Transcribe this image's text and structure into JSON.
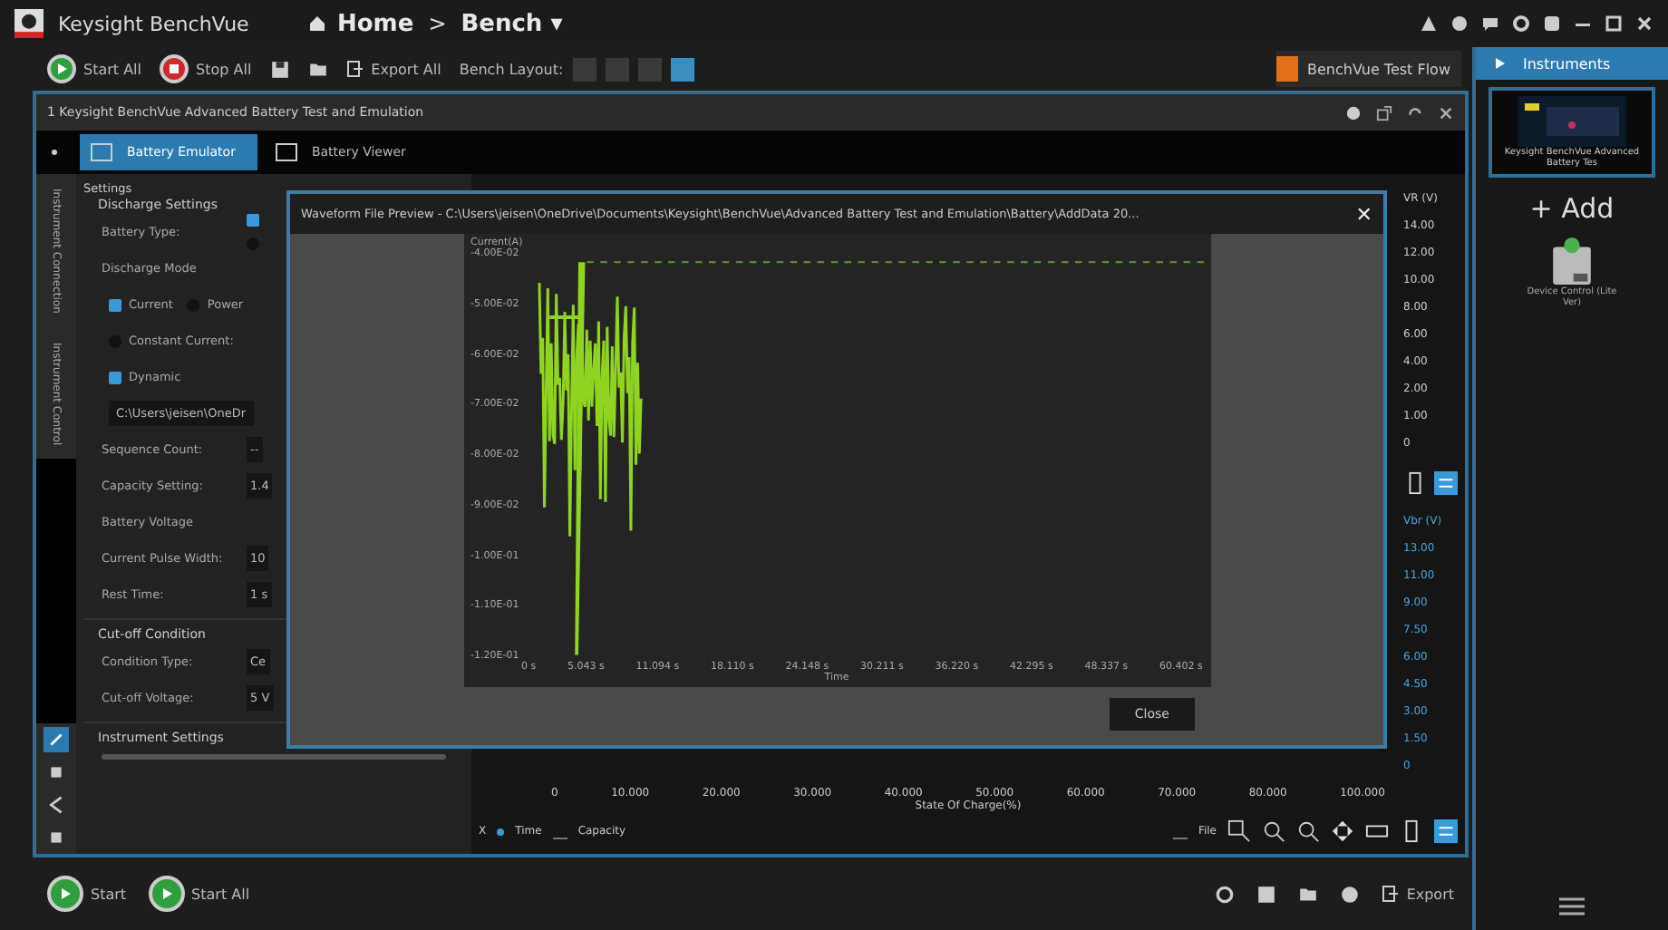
{
  "app": {
    "title": "Keysight BenchVue",
    "breadcrumb": [
      {
        "label": "Home",
        "kind": "home"
      },
      {
        "label": ">",
        "kind": "separator"
      },
      {
        "label": "Bench ▾",
        "kind": "current"
      }
    ]
  },
  "toolbar": {
    "start_all": "Start All",
    "stop_all": "Stop All",
    "export_all": "Export All",
    "layout_label": "Bench Layout:",
    "layouts": [
      {
        "selected": false
      },
      {
        "selected": false
      },
      {
        "selected": false
      },
      {
        "selected": true
      }
    ],
    "test_flow": "BenchVue Test Flow"
  },
  "panel": {
    "title": "1 Keysight BenchVue Advanced Battery Test and Emulation",
    "tabs": [
      {
        "label": "Battery Emulator",
        "selected": true
      },
      {
        "label": "Battery Viewer",
        "selected": false
      }
    ],
    "side_tabs": [
      {
        "label": "Instrument Connection"
      },
      {
        "label": "Instrument Control"
      }
    ],
    "settings": {
      "heading": "Settings",
      "discharge": "Discharge Settings",
      "rows": [
        {
          "kind": "label",
          "label": "Battery Type:",
          "options": [
            {
              "selected": true
            },
            {
              "selected": false
            }
          ]
        },
        {
          "kind": "heading",
          "label": "Discharge Mode"
        },
        {
          "kind": "radios",
          "options": [
            {
              "label": "Current",
              "selected": true
            },
            {
              "label": "Power",
              "selected": false
            }
          ]
        },
        {
          "kind": "radio",
          "label": "Constant Current:",
          "selected": false
        },
        {
          "kind": "radio",
          "label": "Dynamic",
          "selected": true
        },
        {
          "kind": "path",
          "value": "C:\\Users\\jeisen\\OneDr"
        },
        {
          "kind": "field",
          "label": "Sequence Count:",
          "value": "--"
        },
        {
          "kind": "field",
          "label": "Capacity Setting:",
          "value": "1.4"
        },
        {
          "kind": "label",
          "label": "Battery Voltage"
        },
        {
          "kind": "field",
          "label": "Current Pulse Width:",
          "value": "10"
        },
        {
          "kind": "field",
          "label": "Rest Time:",
          "value": "1 s"
        }
      ],
      "cutoff": "Cut-off Condition",
      "cutoff_rows": [
        {
          "label": "Condition Type:",
          "value": "Ce"
        },
        {
          "label": "Cut-off Voltage:",
          "value": "5 V"
        }
      ],
      "instrument": "Instrument Settings"
    },
    "upper_axis": [
      "VR (V)",
      "14.00",
      "12.00",
      "10.00",
      "8.00",
      "6.00",
      "4.00",
      "2.00",
      "1.00",
      "0"
    ],
    "lower_axis": [
      "Vbr (V)",
      "13.00",
      "11.00",
      "9.00",
      "7.50",
      "6.00",
      "4.50",
      "3.00",
      "1.50",
      "0"
    ],
    "x_ticks": [
      "0",
      "10.000",
      "20.000",
      "30.000",
      "40.000",
      "50.000",
      "60.000",
      "70.000",
      "80.000",
      "100.000"
    ],
    "x_title": "State Of Charge(%)",
    "legend": [
      {
        "label": "X",
        "kind": "plain"
      },
      {
        "label": "Time",
        "kind": "dot"
      },
      {
        "label": "Capacity",
        "kind": "box"
      }
    ],
    "file_label": "File"
  },
  "bottom": {
    "start": "Start",
    "start_all": "Start All",
    "export": "Export"
  },
  "sidebar": {
    "tab": "Instruments",
    "instrument_name": "Keysight BenchVue Advanced Battery Tes",
    "add": "+ Add",
    "device": "Device Control (Lite Ver)"
  },
  "dialog": {
    "title": "Waveform File Preview - C:\\Users\\jeisen\\OneDrive\\Documents\\Keysight\\BenchVue\\Advanced Battery Test and Emulation\\Battery\\AddData 20...",
    "close_icon": "✕",
    "y_title": "Current(A)",
    "y_ticks": [
      "-4.00E-02",
      "-5.00E-02",
      "-6.00E-02",
      "-7.00E-02",
      "-8.00E-02",
      "-9.00E-02",
      "-1.00E-01",
      "-1.10E-01",
      "-1.20E-01"
    ],
    "x_ticks": [
      "0 s",
      "5.043 s",
      "11.094 s",
      "18.110 s",
      "24.148 s",
      "30.211 s",
      "36.220 s",
      "42.295 s",
      "48.337 s",
      "60.402 s"
    ],
    "x_title": "Time",
    "close_button": "Close"
  }
}
